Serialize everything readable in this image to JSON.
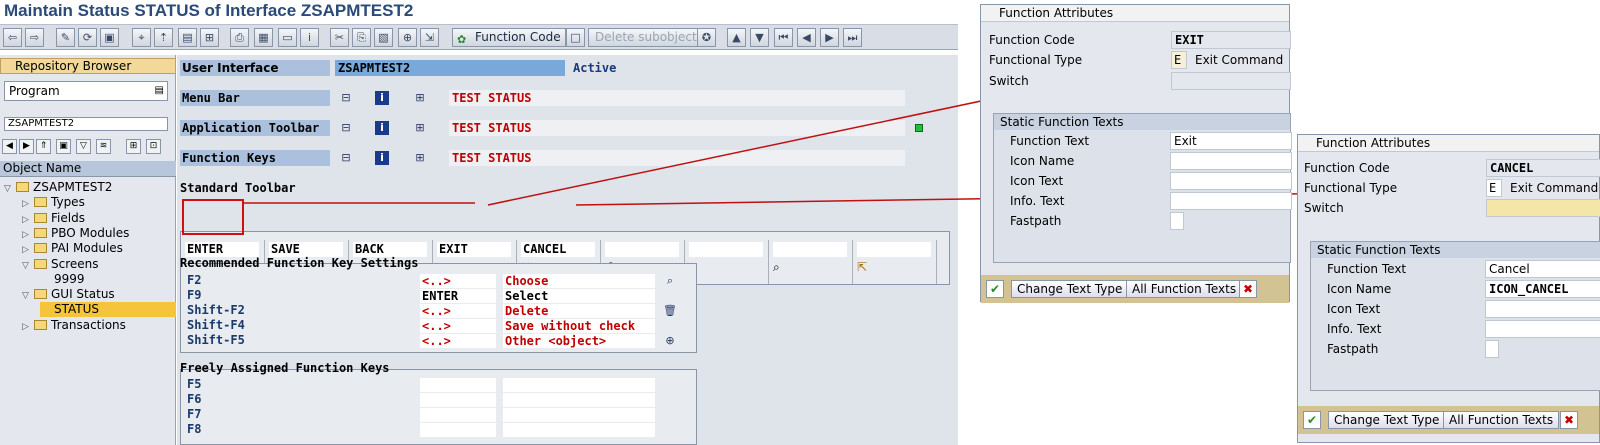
{
  "title": "Maintain Status STATUS of Interface ZSAPMTEST2",
  "toolbar": {
    "function_code": "Function Code",
    "delete_subobject": "Delete subobject"
  },
  "sidebar": {
    "repo_browser": "Repository Browser",
    "program_dropdown": "Program",
    "program_field": "ZSAPMTEST2",
    "object_name": "Object Name",
    "tree": [
      {
        "label": "ZSAPMTEST2",
        "level": 0
      },
      {
        "label": "Types",
        "level": 1
      },
      {
        "label": "Fields",
        "level": 1
      },
      {
        "label": "PBO Modules",
        "level": 1
      },
      {
        "label": "PAI Modules",
        "level": 1
      },
      {
        "label": "Screens",
        "level": 1
      },
      {
        "label": "9999",
        "level": 2
      },
      {
        "label": "GUI Status",
        "level": 1
      },
      {
        "label": "STATUS",
        "level": 2
      },
      {
        "label": "Transactions",
        "level": 1
      }
    ]
  },
  "main": {
    "ui_label": "User Interface",
    "ui_value": "ZSAPMTEST2",
    "ui_status": "Active",
    "menu_bar": "Menu Bar",
    "app_toolbar": "Application Toolbar",
    "function_keys": "Function Keys",
    "test_status": "TEST STATUS",
    "standard_toolbar": "Standard Toolbar",
    "std_buttons": [
      "ENTER",
      "SAVE",
      "BACK",
      "EXIT",
      "CANCEL"
    ],
    "recommended": "Recommended Function Key Settings",
    "rec_rows": [
      {
        "key": "F2",
        "code": "<..>",
        "text": "Choose"
      },
      {
        "key": "F9",
        "code": "ENTER",
        "text": "Select"
      },
      {
        "key": "Shift-F2",
        "code": "<..>",
        "text": "Delete"
      },
      {
        "key": "Shift-F4",
        "code": "<..>",
        "text": "Save without check"
      },
      {
        "key": "Shift-F5",
        "code": "<..>",
        "text": "Other <object>"
      }
    ],
    "freely": "Freely Assigned Function Keys",
    "free_keys": [
      "F5",
      "F6",
      "F7",
      "F8"
    ]
  },
  "popup1": {
    "title": "Function Attributes",
    "fc_label": "Function Code",
    "fc_value": "EXIT",
    "ft_label": "Functional Type",
    "ft_code": "E",
    "ft_text": "Exit Command",
    "switch": "Switch",
    "sft": "Static Function Texts",
    "func_text_label": "Function Text",
    "func_text": "Exit",
    "icon_name": "Icon Name",
    "icon_text": "Icon Text",
    "info_text": "Info. Text",
    "fastpath": "Fastpath",
    "change_text_type": "Change Text Type",
    "all_function_texts": "All Function Texts"
  },
  "popup2": {
    "title": "Function Attributes",
    "fc_label": "Function Code",
    "fc_value": "CANCEL",
    "ft_label": "Functional Type",
    "ft_code": "E",
    "ft_text": "Exit Command",
    "switch": "Switch",
    "sft": "Static Function Texts",
    "func_text_label": "Function Text",
    "func_text": "Cancel",
    "icon_name": "Icon Name",
    "icon_value": "ICON_CANCEL",
    "icon_text": "Icon Text",
    "info_text": "Info. Text",
    "fastpath": "Fastpath",
    "change_text_type": "Change Text Type",
    "all_function_texts": "All Function Texts"
  }
}
